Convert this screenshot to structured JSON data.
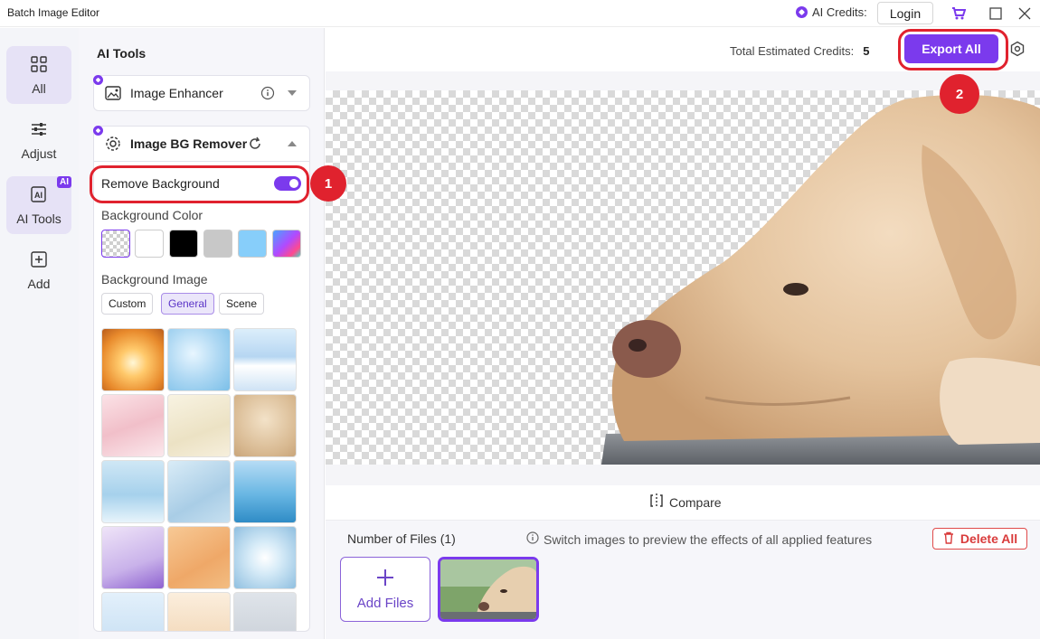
{
  "window": {
    "title": "Batch Image Editor"
  },
  "titlebar": {
    "credits_label": "AI Credits:",
    "login_label": "Login"
  },
  "nav": {
    "items": [
      {
        "label": "All",
        "icon": "grid-icon"
      },
      {
        "label": "Adjust",
        "icon": "sliders-icon"
      },
      {
        "label": "AI Tools",
        "icon": "ai-tools-icon",
        "badge": "AI"
      },
      {
        "label": "Add",
        "icon": "add-square-icon"
      }
    ]
  },
  "panel": {
    "title": "AI Tools",
    "enhancer": {
      "label": "Image Enhancer"
    },
    "bg_remover": {
      "label": "Image BG Remover",
      "remove_bg_label": "Remove Background",
      "remove_bg_enabled": true,
      "bg_color_label": "Background Color",
      "colors": [
        "transparent",
        "#ffffff",
        "#000000",
        "#c8c8c8",
        "#87cefa",
        "gradient"
      ],
      "bg_image_label": "Background Image",
      "tabs": [
        "Custom",
        "General",
        "Scene"
      ],
      "active_tab": "General"
    }
  },
  "main": {
    "credits_label": "Total Estimated Credits:",
    "credits_value": "5",
    "export_label": "Export All",
    "compare_label": "Compare",
    "files_count_label": "Number of Files (1)",
    "hint": "Switch images to preview the effects of all applied features",
    "delete_label": "Delete All",
    "add_files_label": "Add Files"
  },
  "annotations": {
    "step1": "1",
    "step2": "2"
  }
}
